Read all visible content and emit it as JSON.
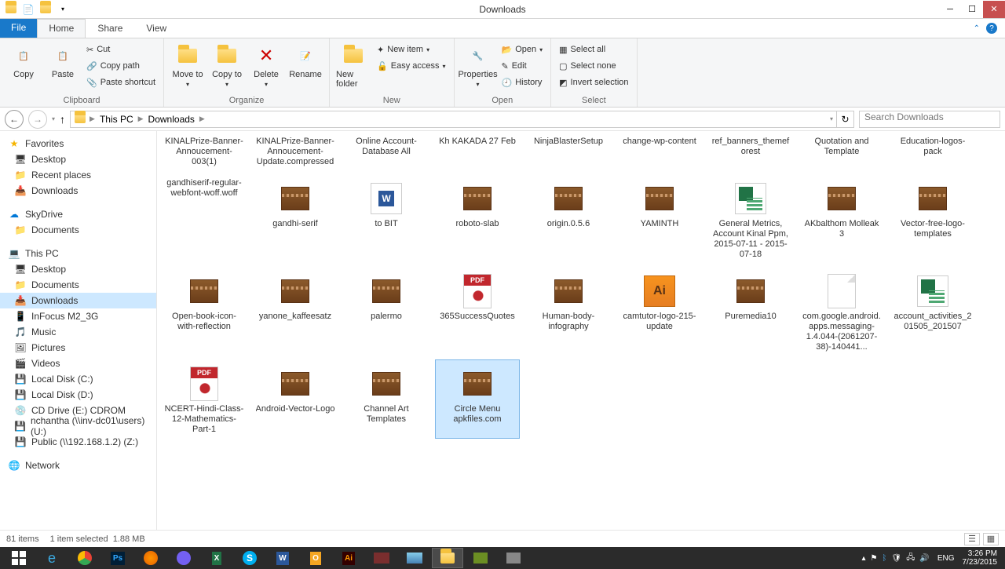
{
  "window": {
    "title": "Downloads"
  },
  "ribbon": {
    "file": "File",
    "tabs": [
      "Home",
      "Share",
      "View"
    ],
    "active_tab": "Home",
    "groups": {
      "clipboard": {
        "label": "Clipboard",
        "copy": "Copy",
        "paste": "Paste",
        "cut": "Cut",
        "copy_path": "Copy path",
        "paste_shortcut": "Paste shortcut"
      },
      "organize": {
        "label": "Organize",
        "move_to": "Move to",
        "copy_to": "Copy to",
        "delete": "Delete",
        "rename": "Rename"
      },
      "new": {
        "label": "New",
        "new_folder": "New folder",
        "new_item": "New item",
        "easy_access": "Easy access"
      },
      "open": {
        "label": "Open",
        "properties": "Properties",
        "open": "Open",
        "edit": "Edit",
        "history": "History"
      },
      "select": {
        "label": "Select",
        "select_all": "Select all",
        "select_none": "Select none",
        "invert": "Invert selection"
      }
    }
  },
  "breadcrumb": {
    "items": [
      "This PC",
      "Downloads"
    ]
  },
  "search": {
    "placeholder": "Search Downloads"
  },
  "sidebar": {
    "favorites": {
      "label": "Favorites",
      "items": [
        "Desktop",
        "Recent places",
        "Downloads"
      ]
    },
    "skydrive": {
      "label": "SkyDrive",
      "items": [
        "Documents"
      ]
    },
    "thispc": {
      "label": "This PC",
      "items": [
        "Desktop",
        "Documents",
        "Downloads",
        "InFocus M2_3G",
        "Music",
        "Pictures",
        "Videos",
        "Local Disk (C:)",
        "Local Disk (D:)",
        "CD Drive (E:) CDROM",
        "nchantha (\\\\inv-dc01\\users) (U:)",
        "Public (\\\\192.168.1.2) (Z:)"
      ]
    },
    "network": {
      "label": "Network"
    }
  },
  "files": [
    {
      "name": "KINALPrize-Banner-Annoucement-003(1)",
      "type": "partial"
    },
    {
      "name": "KINALPrize-Banner-Annoucement-Update.compressed",
      "type": "partial"
    },
    {
      "name": "Online Account-Database All",
      "type": "partial"
    },
    {
      "name": "Kh KAKADA 27 Feb",
      "type": "partial"
    },
    {
      "name": "NinjaBlasterSetup",
      "type": "partial"
    },
    {
      "name": "change-wp-content",
      "type": "partial"
    },
    {
      "name": "ref_banners_themeforest",
      "type": "partial"
    },
    {
      "name": "Quotation and Template",
      "type": "partial"
    },
    {
      "name": "Education-logos-pack",
      "type": "partial"
    },
    {
      "name": "gandhiserif-regular-webfont-woff.woff",
      "type": "partial"
    },
    {
      "name": "gandhi-serif",
      "type": "rar"
    },
    {
      "name": "to BIT",
      "type": "word"
    },
    {
      "name": "roboto-slab",
      "type": "rar"
    },
    {
      "name": "origin.0.5.6",
      "type": "rar"
    },
    {
      "name": "YAMINTH",
      "type": "rar"
    },
    {
      "name": "General Metrics, Account Kinal Ppm, 2015-07-11 - 2015-07-18",
      "type": "excel"
    },
    {
      "name": "AKbalthom Molleak 3",
      "type": "rar"
    },
    {
      "name": "Vector-free-logo-templates",
      "type": "rar"
    },
    {
      "name": "Open-book-icon-with-reflection",
      "type": "rar"
    },
    {
      "name": "yanone_kaffeesatz",
      "type": "rar"
    },
    {
      "name": "palermo",
      "type": "rar"
    },
    {
      "name": "365SuccessQuotes",
      "type": "pdf"
    },
    {
      "name": "Human-body-infography",
      "type": "rar"
    },
    {
      "name": "camtutor-logo-215-update",
      "type": "ai"
    },
    {
      "name": "Puremedia10",
      "type": "rar"
    },
    {
      "name": "com.google.android.apps.messaging-1.4.044-(2061207-38)-140441...",
      "type": "generic"
    },
    {
      "name": "account_activities_201505_201507",
      "type": "excel"
    },
    {
      "name": "NCERT-Hindi-Class-12-Mathematics-Part-1",
      "type": "pdf"
    },
    {
      "name": "Android-Vector-Logo",
      "type": "rar"
    },
    {
      "name": "Channel Art Templates",
      "type": "rar"
    },
    {
      "name": "Circle Menu apkfiles.com",
      "type": "rar",
      "selected": true
    }
  ],
  "status": {
    "items": "81 items",
    "selected": "1 item selected",
    "size": "1.88 MB"
  },
  "tray": {
    "lang": "ENG",
    "time": "3:26 PM",
    "date": "7/23/2015"
  }
}
